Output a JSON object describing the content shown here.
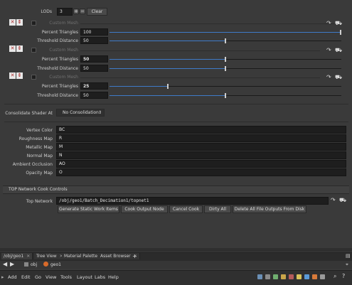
{
  "lods": {
    "label": "LODs",
    "value": "3",
    "clear_label": "Clear"
  },
  "lod_blocks": [
    {
      "custom_mesh_label": "Custom Mesh",
      "percent_label": "Percent Triangles",
      "percent_value": "100",
      "percent_fraction": 1.0,
      "threshold_label": "Threshold Distance",
      "threshold_value": "50",
      "threshold_fraction": 0.5
    },
    {
      "custom_mesh_label": "Custom Mesh",
      "percent_label": "Percent Triangles",
      "percent_value": "50",
      "percent_fraction": 0.5,
      "threshold_label": "Threshold Distance",
      "threshold_value": "50",
      "threshold_fraction": 0.5
    },
    {
      "custom_mesh_label": "Custom Mesh",
      "percent_label": "Percent Triangles",
      "percent_value": "25",
      "percent_fraction": 0.25,
      "threshold_label": "Threshold Distance",
      "threshold_value": "50",
      "threshold_fraction": 0.5
    }
  ],
  "consolidate": {
    "label": "Consolidate Shader At",
    "value": "No Consolidation"
  },
  "maps": [
    {
      "label": "Vertex Color",
      "value": "BC"
    },
    {
      "label": "Roughness Map",
      "value": "R"
    },
    {
      "label": "Metallic Map",
      "value": "M"
    },
    {
      "label": "Normal Map",
      "value": "N"
    },
    {
      "label": "Ambient Occlusion",
      "value": "AO"
    },
    {
      "label": "Opacity Map",
      "value": "O"
    }
  ],
  "top_network": {
    "section_title": "TOP Network Cook Controls",
    "label": "Top Network",
    "value": "/obj/geo1/Batch_Decimation1/topnet1",
    "buttons": [
      "Generate Static Work Items",
      "Cook Output Node",
      "Cancel Cook",
      "Dirty All",
      "Delete All File Outputs From Disk"
    ]
  },
  "tabs": [
    "/obj/geo1",
    "Tree View",
    "Material Palette",
    "Asset Browser",
    "+"
  ],
  "path_bar": {
    "obj": "obj",
    "geo": "geo1"
  },
  "menu": [
    "Add",
    "Edit",
    "Go",
    "View",
    "Tools",
    "Layout",
    "Labs",
    "Help"
  ],
  "colors": {
    "accent": "#3f7ac8",
    "panel": "#3a3a3a",
    "field": "#1e1e1e"
  }
}
